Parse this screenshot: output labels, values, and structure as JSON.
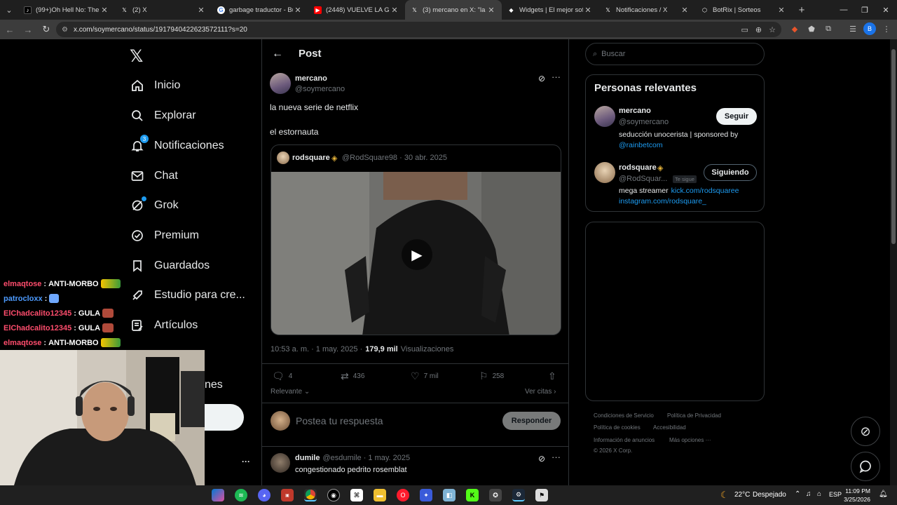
{
  "browser": {
    "tabs": [
      {
        "title": "(99+)Oh Hell No: The Ulti",
        "favicon": "tiktok-icon",
        "color": "#000000"
      },
      {
        "title": "(2) X",
        "favicon": "x-icon",
        "color": "#000000"
      },
      {
        "title": "garbage traductor - Busca",
        "favicon": "google-icon",
        "color": "#ffffff"
      },
      {
        "title": "(2448) VUELVE LA GULA (",
        "favicon": "youtube-icon",
        "color": "#ff0000"
      },
      {
        "title": "(3) mercano en X: \"la nue",
        "favicon": "x-icon",
        "color": "#000000"
      },
      {
        "title": "Widgets | El mejor softw",
        "favicon": "widgets-icon",
        "color": "#ffffff"
      },
      {
        "title": "Notificaciones / X",
        "favicon": "x-icon",
        "color": "#000000"
      },
      {
        "title": "BotRix | Sorteos",
        "favicon": "botrix-icon",
        "color": "#ffffff"
      }
    ],
    "url": "x.com/soymercano/status/1917940422623572111?s=20",
    "profile_initial": "B"
  },
  "sidebar": {
    "items": [
      {
        "label": "Inicio",
        "icon": "home-icon"
      },
      {
        "label": "Explorar",
        "icon": "search-icon"
      },
      {
        "label": "Notificaciones",
        "icon": "bell-icon",
        "badge": "3"
      },
      {
        "label": "Chat",
        "icon": "mail-icon"
      },
      {
        "label": "Grok",
        "icon": "grok-icon"
      },
      {
        "label": "Premium",
        "icon": "verified-icon"
      },
      {
        "label": "Guardados",
        "icon": "bookmark-icon"
      },
      {
        "label": "Estudio para cre...",
        "icon": "rocket-icon"
      },
      {
        "label": "Artículos",
        "icon": "article-icon"
      }
    ],
    "partial_item_label": "nes",
    "more_label": "···"
  },
  "post": {
    "header_title": "Post",
    "author_name": "mercano",
    "author_handle": "@soymercano",
    "text_line1": "la nueva serie de netflix",
    "text_line2": "el estornauta",
    "quote": {
      "name": "rodsquare",
      "handle_date": "@RodSquare98 · 30 abr. 2025"
    },
    "timestamp": "10:53 a. m. · 1 may. 2025 ·",
    "views_count": "179,9 mil",
    "views_label": "Visualizaciones",
    "replies": "4",
    "reposts": "436",
    "likes": "7 mil",
    "bookmarks": "258",
    "sort_label": "Relevante",
    "quotes_label": "Ver citas",
    "reply_placeholder": "Postea tu respuesta",
    "reply_button": "Responder",
    "reply": {
      "name": "dumile",
      "handle_date": "@esdumile · 1 may. 2025",
      "text": "congestionado pedrito rosemblat"
    }
  },
  "right": {
    "search_placeholder": "Buscar",
    "relevant_title": "Personas relevantes",
    "people": [
      {
        "name": "mercano",
        "handle": "@soymercano",
        "button": "Seguir",
        "bio": "seducción unocerista | sponsored by",
        "bio_link": "@rainbetcom"
      },
      {
        "name": "rodsquare",
        "handle": "@RodSquar...",
        "follows_you": "Te sigue",
        "button": "Siguiendo",
        "bio": "mega streamer",
        "bio_link": "kick.com/rodsquaree",
        "bio_link2": "instagram.com/rodsquare_"
      }
    ],
    "footer": [
      "Condiciones de Servicio",
      "Política de Privacidad",
      "Política de cookies",
      "Accesibilidad",
      "Información de anuncios",
      "Más opciones ···",
      "© 2026 X Corp."
    ]
  },
  "stream_chat": [
    {
      "user": "elmaqtose",
      "msg": "ANTI-MORBO",
      "color": "#ff4d6d"
    },
    {
      "user": "patrocloxx",
      "msg": "",
      "color": "#4d9bff"
    },
    {
      "user": "ElChadcalito12345",
      "msg": "GULA",
      "color": "#ff4d6d"
    },
    {
      "user": "ElChadcalito12345",
      "msg": "GULA",
      "color": "#ff4d6d"
    },
    {
      "user": "elmaqtose",
      "msg": "ANTI-MORBO",
      "color": "#ff4d6d"
    }
  ],
  "taskbar": {
    "weather_temp": "22°C",
    "weather_desc": "Despejado",
    "lang": "ESP",
    "time": "11:09 PM",
    "date": "3/25/2026"
  },
  "colors": {
    "accent": "#1d9bf0",
    "background": "#000000",
    "border": "#2f3336"
  }
}
